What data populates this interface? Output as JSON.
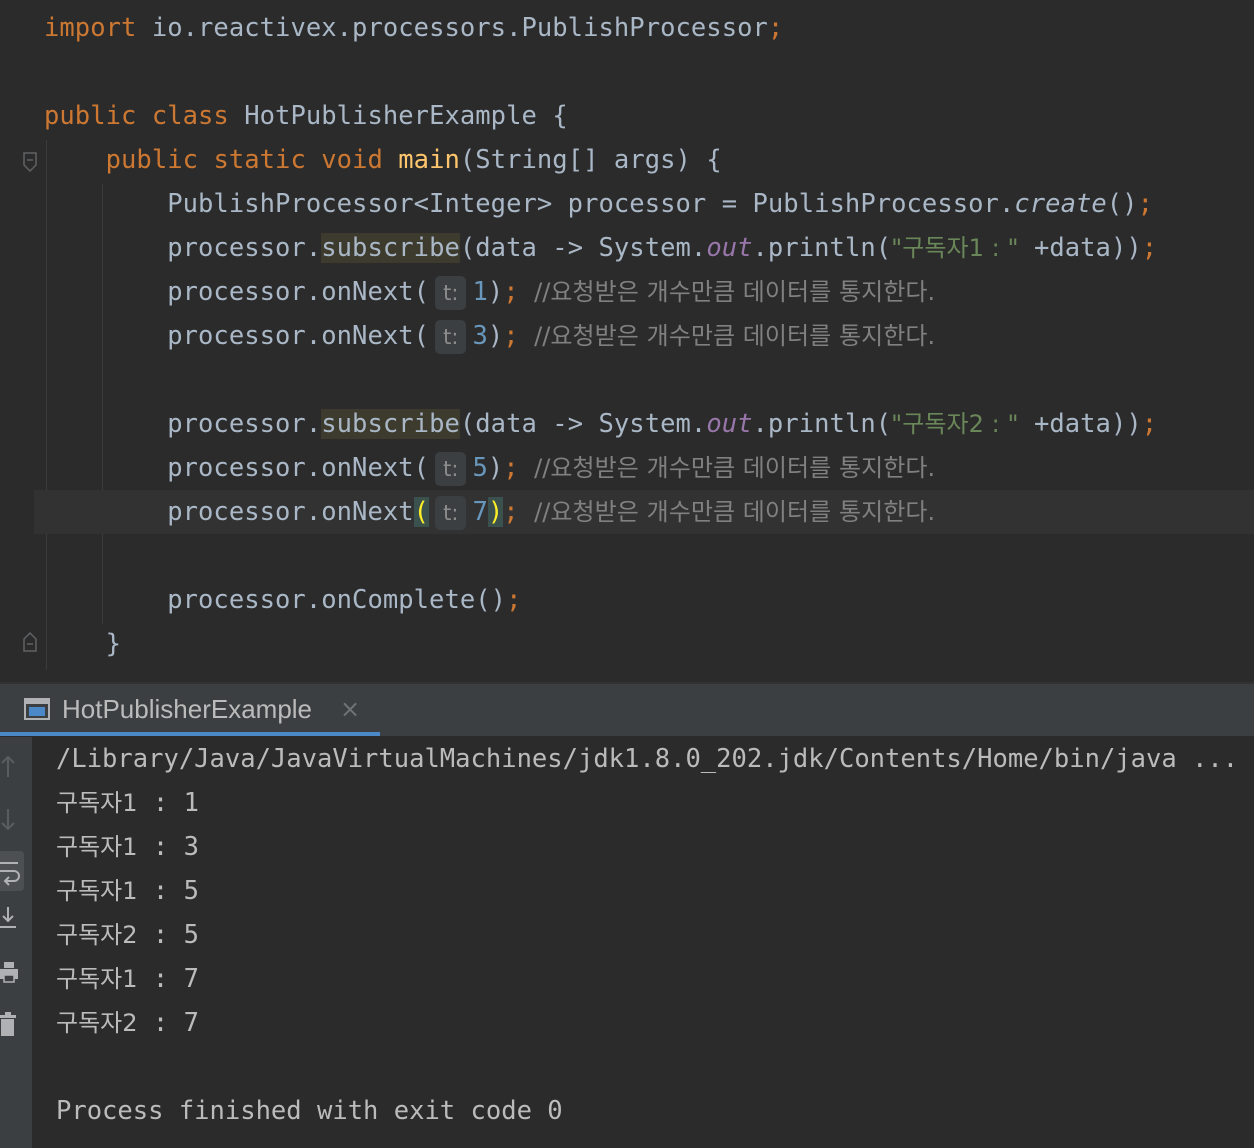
{
  "editor": {
    "lines": {
      "import_kw": "import",
      "import_path": " io.reactivex.processors.PublishProcessor",
      "semicolon": ";",
      "public_kw": "public",
      "class_kw": "class",
      "class_name": "HotPublisherExample",
      "open_brace": "{",
      "static_kw": "static",
      "void_kw": "void",
      "main_name": "main",
      "main_params": "(String[] args) {",
      "decl_type": "PublishProcessor<Integer> processor = PublishProcessor.",
      "create_call": "create",
      "parens": "()",
      "processor_dot": "processor.",
      "subscribe_name": "subscribe",
      "lambda_start": "(data -> System.",
      "out_field": "out",
      "println_call": ".println(",
      "subscriber1_str": "\"구독자1 : \"",
      "subscriber2_str": "\"구독자2 : \"",
      "lambda_end": " +data))",
      "onnext_call": "processor.onNext",
      "param_hint": "t:",
      "arg_1": "1",
      "arg_3": "3",
      "arg_5": "5",
      "arg_7": "7",
      "close_paren": ")",
      "comment": "//요청받은 개수만큼 데이터를 통지한다.",
      "oncomplete_call": "processor.onComplete()",
      "close_brace": "}"
    }
  },
  "run_panel": {
    "tab_label": "HotPublisherExample",
    "tab_close": "×",
    "console": {
      "command": "/Library/Java/JavaVirtualMachines/jdk1.8.0_202.jdk/Contents/Home/bin/java ...",
      "output": [
        {
          "who": "구독자1",
          "value": " : 1"
        },
        {
          "who": "구독자1",
          "value": " : 3"
        },
        {
          "who": "구독자1",
          "value": " : 5"
        },
        {
          "who": "구독자2",
          "value": " : 5"
        },
        {
          "who": "구독자1",
          "value": " : 7"
        },
        {
          "who": "구독자2",
          "value": " : 7"
        }
      ],
      "exit_message": "Process finished with exit code 0"
    },
    "toolbar_icons": [
      "arrow-up-icon",
      "arrow-down-icon",
      "soft-wrap-icon",
      "scroll-to-end-icon",
      "print-icon",
      "trash-icon"
    ]
  },
  "colors": {
    "background": "#2b2b2b",
    "keyword": "#cc7832",
    "function": "#ffc66d",
    "string": "#6a8759",
    "number": "#6897bb",
    "comment": "#808080",
    "static_field": "#9876aa",
    "tab_accent": "#4a88c7"
  }
}
